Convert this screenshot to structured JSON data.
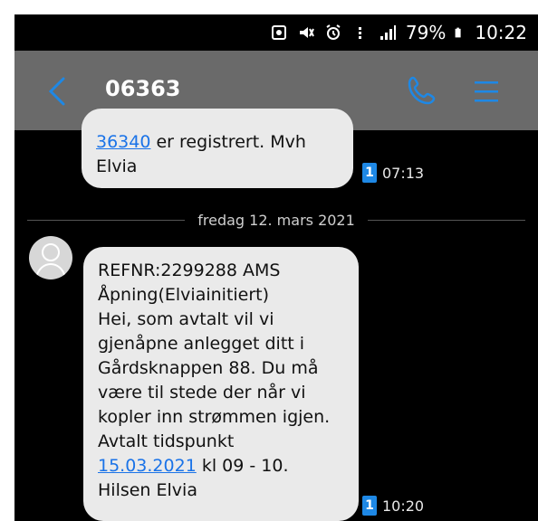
{
  "status_bar": {
    "battery": "79%",
    "time": "10:22",
    "icons": [
      "screenshot-icon",
      "mute-icon",
      "alarm-icon",
      "data-icon",
      "signal-icon",
      "battery-icon"
    ]
  },
  "header": {
    "back_icon": "chevron-left-icon",
    "contact": "06363",
    "call_icon": "phone-icon",
    "menu_icon": "hamburger-menu-icon"
  },
  "messages": [
    {
      "line1_link": "36340",
      "line1_text": " er registrert. Mvh",
      "line2": "Elvia",
      "sim": "1",
      "time": "07:13"
    },
    {
      "date": "fredag 12. mars 2021",
      "lines": [
        "REFNR:2299288 AMS",
        "Åpning(Elviainitiert)",
        "Hei, som avtalt vil vi",
        "gjenåpne anlegget ditt i",
        "Gårdsknappen 88. Du må",
        "være til stede der når vi",
        "kopler inn strømmen igjen.",
        "Avtalt tidspunkt"
      ],
      "date_link": "15.03.2021",
      "after_link": " kl 09 - 10.",
      "last_line": "Hilsen Elvia",
      "sim": "1",
      "time": "10:20"
    }
  ],
  "colors": {
    "app_bar": "#6a6a6a",
    "accent": "#1e88e5",
    "bubble": "#eaeaea",
    "link": "#1a73e8"
  }
}
